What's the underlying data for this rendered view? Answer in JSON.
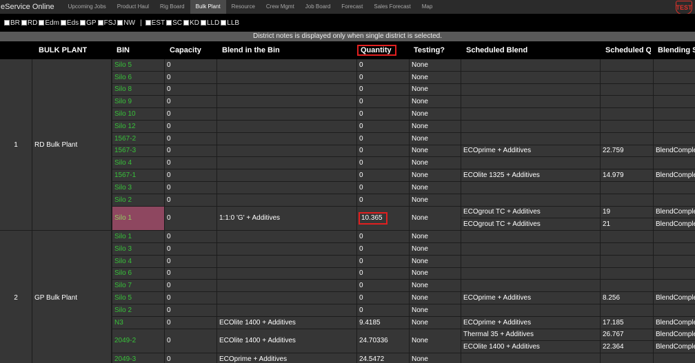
{
  "app": {
    "title": "eService Online",
    "badge": "TEST"
  },
  "nav": {
    "tabs": [
      {
        "label": "Upcoming Jobs",
        "active": false
      },
      {
        "label": "Product Haul",
        "active": false
      },
      {
        "label": "Rig Board",
        "active": false
      },
      {
        "label": "Bulk Plant",
        "active": true
      },
      {
        "label": "Resource",
        "active": false
      },
      {
        "label": "Crew Mgmt",
        "active": false
      },
      {
        "label": "Job Board",
        "active": false
      },
      {
        "label": "Forecast",
        "active": false
      },
      {
        "label": "Sales Forecast",
        "active": false
      },
      {
        "label": "Map",
        "active": false
      }
    ]
  },
  "filters": {
    "group1": [
      "BR",
      "RD",
      "Edm",
      "Eds",
      "GP",
      "FSJ",
      "NW"
    ],
    "separator": "|",
    "group2": [
      "EST",
      "SC",
      "KD",
      "LLD",
      "LLB"
    ]
  },
  "notice": "District notes is displayed only when single district is selected.",
  "headers": {
    "bulk_plant": "BULK PLANT",
    "bin": "BIN",
    "capacity": "Capacity",
    "blend": "Blend in the Bin",
    "quantity": "Quantity",
    "testing": "Testing?",
    "scheduled_blend": "Scheduled Blend",
    "scheduled_qty": "Scheduled QTY",
    "blending_status": "Blending Status"
  },
  "groups": [
    {
      "num": "1",
      "name": "RD Bulk Plant",
      "rows": [
        {
          "bin": "Silo 5",
          "capacity": "0",
          "blend": "",
          "quantity": "0",
          "testing": "None",
          "sched": []
        },
        {
          "bin": "Silo 6",
          "capacity": "0",
          "blend": "",
          "quantity": "0",
          "testing": "None",
          "sched": []
        },
        {
          "bin": "Silo 8",
          "capacity": "0",
          "blend": "",
          "quantity": "0",
          "testing": "None",
          "sched": []
        },
        {
          "bin": "Silo 9",
          "capacity": "0",
          "blend": "",
          "quantity": "0",
          "testing": "None",
          "sched": []
        },
        {
          "bin": "Silo 10",
          "capacity": "0",
          "blend": "",
          "quantity": "0",
          "testing": "None",
          "sched": []
        },
        {
          "bin": "Silo 12",
          "capacity": "0",
          "blend": "",
          "quantity": "0",
          "testing": "None",
          "sched": []
        },
        {
          "bin": "1567-2",
          "capacity": "0",
          "blend": "",
          "quantity": "0",
          "testing": "None",
          "sched": []
        },
        {
          "bin": "1567-3",
          "capacity": "0",
          "blend": "",
          "quantity": "0",
          "testing": "None",
          "sched": [
            {
              "blend": "ECOprime + Additives",
              "qty": "22.759",
              "status": "BlendCompleted"
            }
          ]
        },
        {
          "bin": "Silo 4",
          "capacity": "0",
          "blend": "",
          "quantity": "0",
          "testing": "None",
          "sched": []
        },
        {
          "bin": "1567-1",
          "capacity": "0",
          "blend": "",
          "quantity": "0",
          "testing": "None",
          "sched": [
            {
              "blend": "ECOlite 1325 + Additives",
              "qty": "14.979",
              "status": "BlendCompleted"
            }
          ]
        },
        {
          "bin": "Silo 3",
          "capacity": "0",
          "blend": "",
          "quantity": "0",
          "testing": "None",
          "sched": []
        },
        {
          "bin": "Silo 2",
          "capacity": "0",
          "blend": "",
          "quantity": "0",
          "testing": "None",
          "sched": []
        },
        {
          "bin": "Silo 1",
          "capacity": "0",
          "blend": "1:1:0 'G' + Additives",
          "quantity": "10.365",
          "testing": "None",
          "highlight": true,
          "sched": [
            {
              "blend": "ECOgrout TC + Additives",
              "qty": "19",
              "status": "BlendCompleted"
            },
            {
              "blend": "ECOgrout TC + Additives",
              "qty": "21",
              "status": "BlendCompleted"
            }
          ]
        }
      ]
    },
    {
      "num": "2",
      "name": "GP Bulk Plant",
      "rows": [
        {
          "bin": "Silo 1",
          "capacity": "0",
          "blend": "",
          "quantity": "0",
          "testing": "None",
          "sched": []
        },
        {
          "bin": "Silo 3",
          "capacity": "0",
          "blend": "",
          "quantity": "0",
          "testing": "None",
          "sched": []
        },
        {
          "bin": "Silo 4",
          "capacity": "0",
          "blend": "",
          "quantity": "0",
          "testing": "None",
          "sched": []
        },
        {
          "bin": "Silo 6",
          "capacity": "0",
          "blend": "",
          "quantity": "0",
          "testing": "None",
          "sched": []
        },
        {
          "bin": "Silo 7",
          "capacity": "0",
          "blend": "",
          "quantity": "0",
          "testing": "None",
          "sched": []
        },
        {
          "bin": "Silo 5",
          "capacity": "0",
          "blend": "",
          "quantity": "0",
          "testing": "None",
          "sched": [
            {
              "blend": "ECOprime + Additives",
              "qty": "8.256",
              "status": "BlendCompleted"
            }
          ]
        },
        {
          "bin": "Silo 2",
          "capacity": "0",
          "blend": "",
          "quantity": "0",
          "testing": "None",
          "sched": []
        },
        {
          "bin": "N3",
          "capacity": "0",
          "blend": "ECOlite 1400 + Additives",
          "quantity": "9.4185",
          "testing": "None",
          "sched": [
            {
              "blend": "ECOprime + Additives",
              "qty": "17.185",
              "status": "BlendCompleted"
            }
          ]
        },
        {
          "bin": "2049-2",
          "capacity": "0",
          "blend": "ECOlite 1400 + Additives",
          "quantity": "24.70336",
          "testing": "None",
          "sched": [
            {
              "blend": "Thermal 35 + Additives",
              "qty": "26.767",
              "status": "BlendCompleted"
            },
            {
              "blend": "ECOlite 1400 + Additives",
              "qty": "22.364",
              "status": "BlendCompleted"
            }
          ]
        },
        {
          "bin": "2049-3",
          "capacity": "0",
          "blend": "ECOprime + Additives",
          "quantity": "24.5472",
          "testing": "None",
          "sched": []
        }
      ]
    }
  ]
}
